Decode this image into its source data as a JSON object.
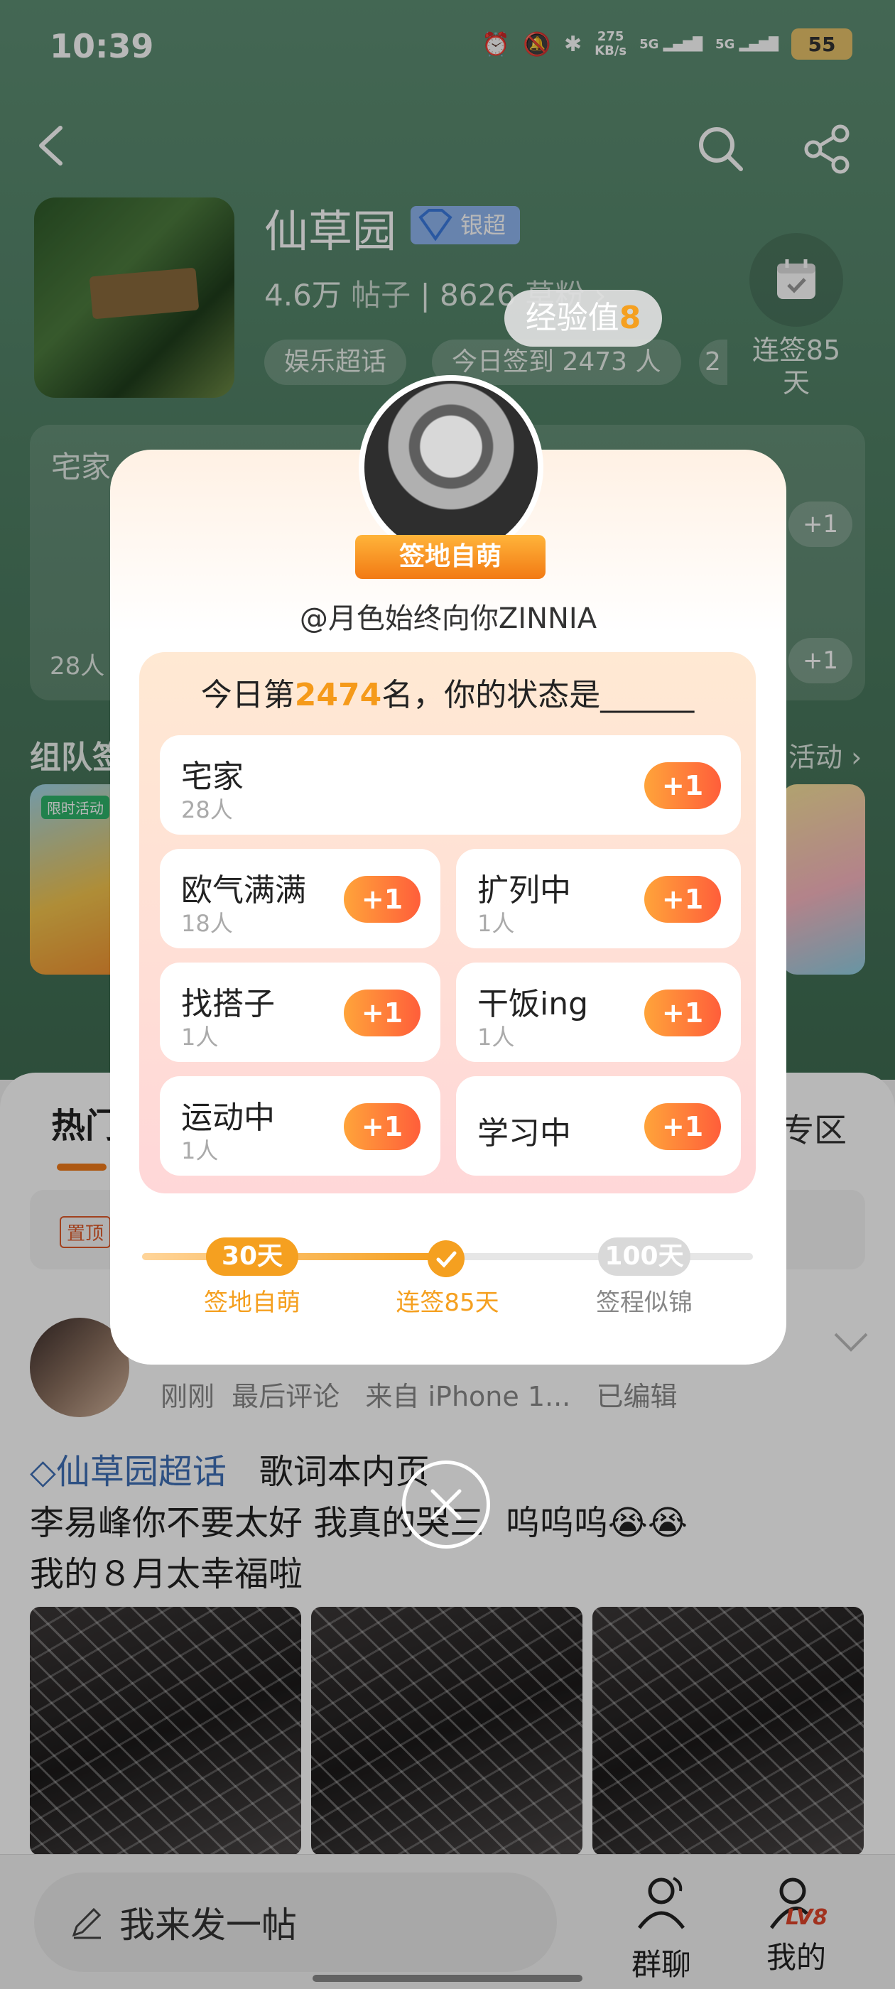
{
  "status_bar": {
    "time": "10:39",
    "speed_value": "275",
    "speed_unit": "KB/s",
    "sig1": "5G",
    "sig2": "5G",
    "battery": "55"
  },
  "header": {
    "title": "仙草园",
    "badge": "银超",
    "posts_count": "4.6万",
    "posts_label": "帖子",
    "fans_count": "8626",
    "fans_label": "草粉",
    "tags": [
      "娱乐超话",
      "今日签到 2473 人",
      "2"
    ],
    "checkin_label": "连签85\n天"
  },
  "background_card": {
    "label": "宅家",
    "count": "28人",
    "plus": "+1",
    "team_title": "组队签",
    "team_more": "活动",
    "activity_tag": "限时活动"
  },
  "feed": {
    "tab_hot": "热门",
    "tab_zone": "专区",
    "pinned": "置顶",
    "meta": "刚刚  最后评论   来自 iPhone 1...   已编辑",
    "topic": "仙草园超话",
    "line1_rest": "   歌词本内页",
    "line2": "李易峰你不要太好 我真的哭三  呜呜呜😭😭",
    "line3": "我的８月太幸福啦"
  },
  "bottom_bar": {
    "post_placeholder": "我来发一帖",
    "group_chat": "群聊",
    "mine": "我的",
    "level": "LV8"
  },
  "overlay": {
    "exp_label": "经验值",
    "exp_value": "8",
    "ribbon": "签地自萌",
    "username": "@月色始终向你ZINNIA",
    "question_prefix": "今日第",
    "rank": "2474",
    "question_suffix": "名，你的状态是______",
    "options": [
      {
        "name": "宅家",
        "count": "28人",
        "plus": "+1"
      },
      {
        "name": "欧气满满",
        "count": "18人",
        "plus": "+1"
      },
      {
        "name": "扩列中",
        "count": "1人",
        "plus": "+1"
      },
      {
        "name": "找搭子",
        "count": "1人",
        "plus": "+1"
      },
      {
        "name": "干饭ing",
        "count": "1人",
        "plus": "+1"
      },
      {
        "name": "运动中",
        "count": "1人",
        "plus": "+1"
      },
      {
        "name": "学习中",
        "count": "",
        "plus": "+1"
      }
    ],
    "progress_fraction": 0.48,
    "milestones": [
      {
        "badge": "30天",
        "label": "签地自萌"
      },
      {
        "badge": "",
        "label": "连签85天"
      },
      {
        "badge": "100天",
        "label": "签程似锦"
      }
    ],
    "accent": "#f5a020"
  }
}
